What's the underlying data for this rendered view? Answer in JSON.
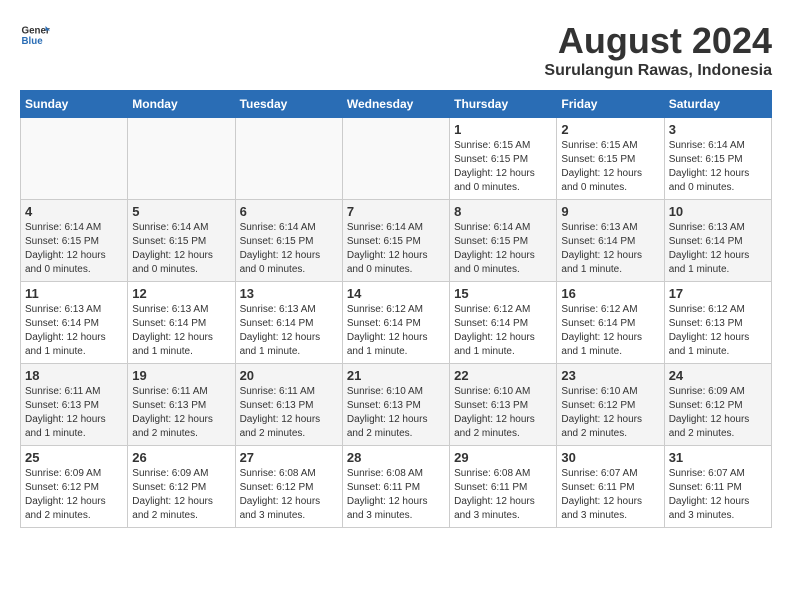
{
  "header": {
    "logo_general": "General",
    "logo_blue": "Blue",
    "main_title": "August 2024",
    "subtitle": "Surulangun Rawas, Indonesia"
  },
  "weekdays": [
    "Sunday",
    "Monday",
    "Tuesday",
    "Wednesday",
    "Thursday",
    "Friday",
    "Saturday"
  ],
  "weeks": [
    [
      {
        "day": "",
        "info": ""
      },
      {
        "day": "",
        "info": ""
      },
      {
        "day": "",
        "info": ""
      },
      {
        "day": "",
        "info": ""
      },
      {
        "day": "1",
        "info": "Sunrise: 6:15 AM\nSunset: 6:15 PM\nDaylight: 12 hours and 0 minutes."
      },
      {
        "day": "2",
        "info": "Sunrise: 6:15 AM\nSunset: 6:15 PM\nDaylight: 12 hours and 0 minutes."
      },
      {
        "day": "3",
        "info": "Sunrise: 6:14 AM\nSunset: 6:15 PM\nDaylight: 12 hours and 0 minutes."
      }
    ],
    [
      {
        "day": "4",
        "info": "Sunrise: 6:14 AM\nSunset: 6:15 PM\nDaylight: 12 hours and 0 minutes."
      },
      {
        "day": "5",
        "info": "Sunrise: 6:14 AM\nSunset: 6:15 PM\nDaylight: 12 hours and 0 minutes."
      },
      {
        "day": "6",
        "info": "Sunrise: 6:14 AM\nSunset: 6:15 PM\nDaylight: 12 hours and 0 minutes."
      },
      {
        "day": "7",
        "info": "Sunrise: 6:14 AM\nSunset: 6:15 PM\nDaylight: 12 hours and 0 minutes."
      },
      {
        "day": "8",
        "info": "Sunrise: 6:14 AM\nSunset: 6:15 PM\nDaylight: 12 hours and 0 minutes."
      },
      {
        "day": "9",
        "info": "Sunrise: 6:13 AM\nSunset: 6:14 PM\nDaylight: 12 hours and 1 minute."
      },
      {
        "day": "10",
        "info": "Sunrise: 6:13 AM\nSunset: 6:14 PM\nDaylight: 12 hours and 1 minute."
      }
    ],
    [
      {
        "day": "11",
        "info": "Sunrise: 6:13 AM\nSunset: 6:14 PM\nDaylight: 12 hours and 1 minute."
      },
      {
        "day": "12",
        "info": "Sunrise: 6:13 AM\nSunset: 6:14 PM\nDaylight: 12 hours and 1 minute."
      },
      {
        "day": "13",
        "info": "Sunrise: 6:13 AM\nSunset: 6:14 PM\nDaylight: 12 hours and 1 minute."
      },
      {
        "day": "14",
        "info": "Sunrise: 6:12 AM\nSunset: 6:14 PM\nDaylight: 12 hours and 1 minute."
      },
      {
        "day": "15",
        "info": "Sunrise: 6:12 AM\nSunset: 6:14 PM\nDaylight: 12 hours and 1 minute."
      },
      {
        "day": "16",
        "info": "Sunrise: 6:12 AM\nSunset: 6:14 PM\nDaylight: 12 hours and 1 minute."
      },
      {
        "day": "17",
        "info": "Sunrise: 6:12 AM\nSunset: 6:13 PM\nDaylight: 12 hours and 1 minute."
      }
    ],
    [
      {
        "day": "18",
        "info": "Sunrise: 6:11 AM\nSunset: 6:13 PM\nDaylight: 12 hours and 1 minute."
      },
      {
        "day": "19",
        "info": "Sunrise: 6:11 AM\nSunset: 6:13 PM\nDaylight: 12 hours and 2 minutes."
      },
      {
        "day": "20",
        "info": "Sunrise: 6:11 AM\nSunset: 6:13 PM\nDaylight: 12 hours and 2 minutes."
      },
      {
        "day": "21",
        "info": "Sunrise: 6:10 AM\nSunset: 6:13 PM\nDaylight: 12 hours and 2 minutes."
      },
      {
        "day": "22",
        "info": "Sunrise: 6:10 AM\nSunset: 6:13 PM\nDaylight: 12 hours and 2 minutes."
      },
      {
        "day": "23",
        "info": "Sunrise: 6:10 AM\nSunset: 6:12 PM\nDaylight: 12 hours and 2 minutes."
      },
      {
        "day": "24",
        "info": "Sunrise: 6:09 AM\nSunset: 6:12 PM\nDaylight: 12 hours and 2 minutes."
      }
    ],
    [
      {
        "day": "25",
        "info": "Sunrise: 6:09 AM\nSunset: 6:12 PM\nDaylight: 12 hours and 2 minutes."
      },
      {
        "day": "26",
        "info": "Sunrise: 6:09 AM\nSunset: 6:12 PM\nDaylight: 12 hours and 2 minutes."
      },
      {
        "day": "27",
        "info": "Sunrise: 6:08 AM\nSunset: 6:12 PM\nDaylight: 12 hours and 3 minutes."
      },
      {
        "day": "28",
        "info": "Sunrise: 6:08 AM\nSunset: 6:11 PM\nDaylight: 12 hours and 3 minutes."
      },
      {
        "day": "29",
        "info": "Sunrise: 6:08 AM\nSunset: 6:11 PM\nDaylight: 12 hours and 3 minutes."
      },
      {
        "day": "30",
        "info": "Sunrise: 6:07 AM\nSunset: 6:11 PM\nDaylight: 12 hours and 3 minutes."
      },
      {
        "day": "31",
        "info": "Sunrise: 6:07 AM\nSunset: 6:11 PM\nDaylight: 12 hours and 3 minutes."
      }
    ]
  ]
}
